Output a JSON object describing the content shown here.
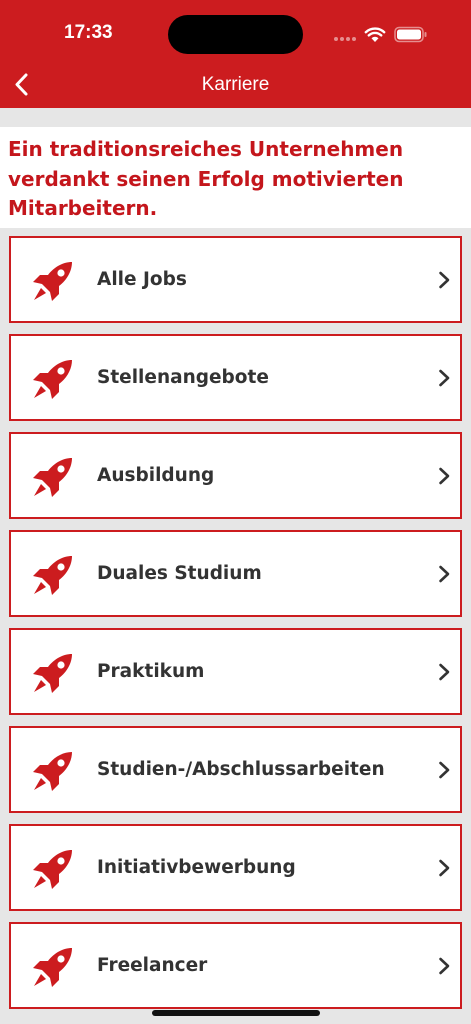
{
  "status_bar": {
    "time": "17:33"
  },
  "nav": {
    "title": "Karriere",
    "back_icon": "chevron-left-icon"
  },
  "intro": {
    "text": "Ein traditionsreiches Unternehmen verdankt seinen Erfolg motivierten Mitarbeitern."
  },
  "colors": {
    "brand_red": "#cc1c1f",
    "text_dark": "#333333",
    "background": "#e6e6e6"
  },
  "list": {
    "item_icon": "rocket-icon",
    "trailing_icon": "chevron-right-icon",
    "items": [
      {
        "label": "Alle Jobs"
      },
      {
        "label": "Stellenangebote"
      },
      {
        "label": "Ausbildung"
      },
      {
        "label": "Duales Studium"
      },
      {
        "label": "Praktikum"
      },
      {
        "label": "Studien-/Abschlussarbeiten"
      },
      {
        "label": "Initiativbewerbung"
      },
      {
        "label": "Freelancer"
      }
    ]
  }
}
